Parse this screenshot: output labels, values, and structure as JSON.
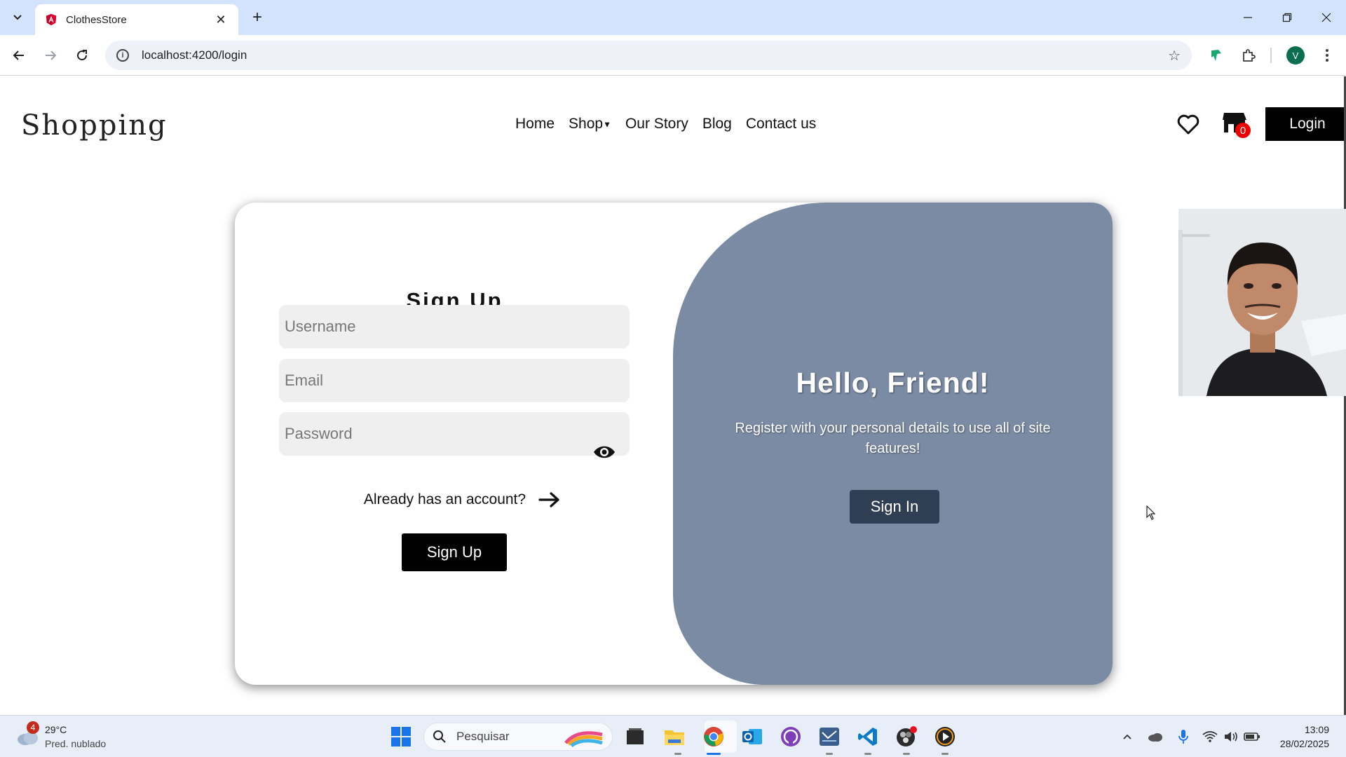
{
  "browser": {
    "tab_title": "ClothesStore",
    "new_tab_label": "+",
    "url": "localhost:4200/login",
    "profile_initial": "V"
  },
  "site": {
    "logo": "Shopping",
    "nav": [
      {
        "label": "Home"
      },
      {
        "label": "Shop"
      },
      {
        "label": "Our Story"
      },
      {
        "label": "Blog"
      },
      {
        "label": "Contact us"
      }
    ],
    "cart_count": "0",
    "login_label": "Login"
  },
  "signup": {
    "title": "Sign Up",
    "username_placeholder": "Username",
    "email_placeholder": "Email",
    "password_placeholder": "Password",
    "already_text": "Already has an account?",
    "button_label": "Sign Up"
  },
  "panel": {
    "heading": "Hello, Friend!",
    "text": "Register with your personal details to use all of site features!",
    "button_label": "Sign In",
    "color": "#7b8ba4"
  },
  "taskbar": {
    "weather_badge": "4",
    "temperature": "29°C",
    "weather_desc": "Pred. nublado",
    "search_placeholder": "Pesquisar",
    "time": "13:09",
    "date": "28/02/2025"
  }
}
